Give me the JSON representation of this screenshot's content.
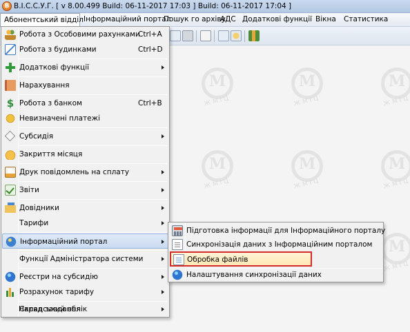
{
  "window": {
    "title": "В.І.С.С.У.Г. [ v 8.00.499 Build: 06-11-2017 17:03 ]   Build: 06-11-2017 17:04 ]",
    "app_icon_letter": "В"
  },
  "menubar": {
    "items": [
      {
        "label": "Абонентський відділ",
        "active": true
      },
      {
        "label": "Інформаційний портал"
      },
      {
        "label": "Пошук го архіву"
      },
      {
        "label": "АДС"
      },
      {
        "label": "Додаткові функції"
      },
      {
        "label": "Вікна"
      },
      {
        "label": "Статистика"
      }
    ]
  },
  "main_menu": {
    "items": [
      {
        "label": "Робота з Особовими рахунками",
        "shortcut": "Ctrl+A",
        "icon": "people-icon"
      },
      {
        "label": "Робота з будинками",
        "shortcut": "Ctrl+D",
        "icon": "house-icon"
      },
      {
        "label": "Додаткові функції",
        "submenu": true,
        "icon": "plus-icon"
      },
      {
        "label": "Нарахування",
        "icon": "book-icon"
      },
      {
        "label": "Робота з банком",
        "shortcut": "Ctrl+B",
        "icon": "dollar-icon"
      },
      {
        "label": "Невизначені платежі",
        "icon": "coins-icon"
      },
      {
        "label": "Субсидія",
        "submenu": true,
        "icon": "diamond-icon"
      },
      {
        "label": "Закриття місяця",
        "icon": "lock-icon"
      },
      {
        "label": "Друк повідомлень на сплату",
        "submenu": true,
        "icon": "print-icon"
      },
      {
        "label": "Звіти",
        "submenu": true,
        "icon": "check-icon"
      },
      {
        "label": "Довідники",
        "submenu": true,
        "icon": "folder-icon"
      },
      {
        "label": "Тарифи",
        "submenu": true
      },
      {
        "label": "Інформаційний портал",
        "submenu": true,
        "icon": "globe-icon",
        "highlighted": true
      },
      {
        "label": "Функції Адміністратора системи",
        "submenu": true
      },
      {
        "label": "Реєстри на субсидію",
        "submenu": true,
        "icon": "globe-small-icon"
      },
      {
        "label": "Розрахунок тарифу",
        "submenu": true,
        "icon": "bars-icon"
      },
      {
        "label": "Складський облік",
        "submenu": true
      },
      {
        "label": "Наряд завдання"
      }
    ]
  },
  "portal_submenu": {
    "items": [
      {
        "label": "Підготовка інформації для Інформаційного порталу",
        "icon": "calc-icon"
      },
      {
        "label": "Синхронізація даних з Інформаційним порталом",
        "icon": "doc-sync-icon"
      },
      {
        "label": "Обробка файлів",
        "icon": "doc-icon",
        "framed": true
      },
      {
        "label": "Налаштування синхронізації даних",
        "icon": "globe-icon"
      }
    ]
  },
  "watermark": {
    "letter": "М",
    "text": "ЖМІЦ"
  },
  "colors": {
    "highlight_frame": "#d62b2b",
    "menu_hover": "#cadbf1"
  }
}
